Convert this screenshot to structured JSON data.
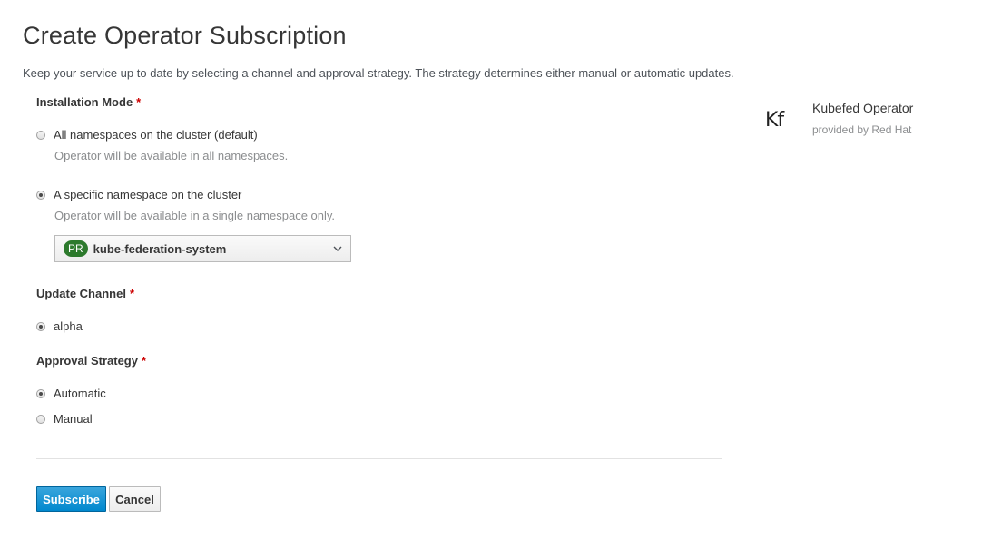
{
  "header": {
    "title": "Create Operator Subscription",
    "subtitle": "Keep your service up to date by selecting a channel and approval strategy. The strategy determines either manual or automatic updates."
  },
  "installation_mode": {
    "label": "Installation Mode",
    "required_marker": "*",
    "options": [
      {
        "label": "All namespaces on the cluster (default)",
        "helper": "Operator will be available in all namespaces.",
        "selected": false
      },
      {
        "label": "A specific namespace on the cluster",
        "helper": "Operator will be available in a single namespace only.",
        "selected": true
      }
    ],
    "namespace_select": {
      "badge": "PR",
      "value": "kube-federation-system",
      "badge_color": "#2d7a2d",
      "icon": "chevron-down-icon"
    }
  },
  "update_channel": {
    "label": "Update Channel",
    "required_marker": "*",
    "options": [
      {
        "label": "alpha",
        "selected": true
      }
    ]
  },
  "approval_strategy": {
    "label": "Approval Strategy",
    "required_marker": "*",
    "options": [
      {
        "label": "Automatic",
        "selected": true
      },
      {
        "label": "Manual",
        "selected": false
      }
    ]
  },
  "actions": {
    "subscribe_label": "Subscribe",
    "cancel_label": "Cancel",
    "primary_color": "#0088ce"
  },
  "operator": {
    "logo_text": "Kf",
    "name": "Kubefed Operator",
    "provider": "provided by Red Hat"
  }
}
